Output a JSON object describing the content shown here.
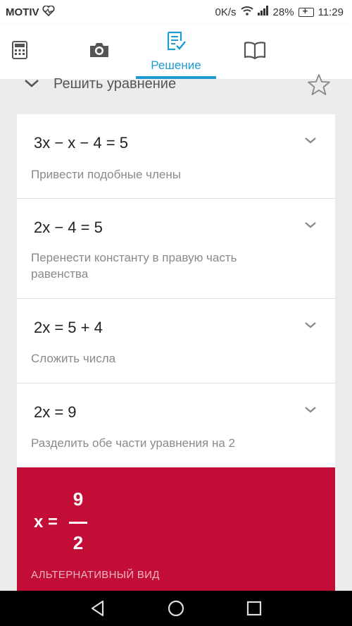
{
  "status_bar": {
    "carrier": "MOTIV",
    "net_speed": "0K/s",
    "battery": "28%",
    "time": "11:29"
  },
  "tabs": [
    {
      "name": "calculator-icon"
    },
    {
      "name": "camera-icon"
    },
    {
      "name": "solution-icon",
      "label": "Решение",
      "active": true
    },
    {
      "name": "book-icon"
    }
  ],
  "section": {
    "title": "Решить уравнение"
  },
  "steps": [
    {
      "equation": "3x − x − 4 = 5",
      "description": "Привести подобные члены"
    },
    {
      "equation": "2x − 4 = 5",
      "description": "Перенести константу в правую часть равенства"
    },
    {
      "equation": "2x = 5 + 4",
      "description": "Сложить числа"
    },
    {
      "equation": "2x = 9",
      "description": "Разделить обе части уравнения на 2"
    }
  ],
  "result": {
    "lhs": "x =",
    "numerator": "9",
    "denominator": "2",
    "alt_view": "АЛЬТЕРНАТИВНЫЙ ВИД"
  },
  "colors": {
    "accent": "#1e9bd2",
    "result_bg": "#c20d36"
  }
}
